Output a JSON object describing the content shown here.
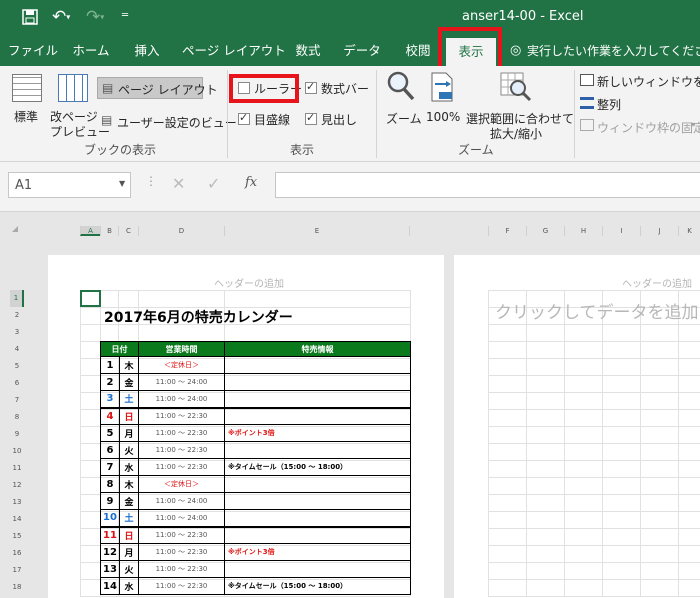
{
  "titlebar": {
    "title": "anser14-00 - Excel",
    "save_icon": "save-icon",
    "undo_icon": "undo-icon",
    "redo_icon": "redo-icon",
    "customize_icon": "customize-icon"
  },
  "tabs": [
    {
      "label": "ファイル"
    },
    {
      "label": "ホーム"
    },
    {
      "label": "挿入"
    },
    {
      "label": "ページ レイアウト"
    },
    {
      "label": "数式"
    },
    {
      "label": "データ"
    },
    {
      "label": "校閲"
    },
    {
      "label": "表示",
      "active": true
    }
  ],
  "tell_me": "実行したい作業を入力してください",
  "ribbon": {
    "views": {
      "normal": "標準",
      "page_break_l1": "改ページ",
      "page_break_l2": "プレビュー",
      "page_layout": "ページ レイアウト",
      "custom_views": "ユーザー設定のビュー",
      "group": "ブックの表示"
    },
    "show": {
      "ruler": "ルーラー",
      "formula_bar": "数式バー",
      "gridlines": "目盛線",
      "headings": "見出し",
      "group": "表示",
      "ruler_checked": false,
      "formula_bar_checked": true,
      "gridlines_checked": true,
      "headings_checked": true
    },
    "zoom": {
      "zoom": "ズーム",
      "hundred": "100%",
      "selection_l1": "選択範囲に合わせて",
      "selection_l2": "拡大/縮小",
      "group": "ズーム"
    },
    "window": {
      "new_window": "新しいウィンドウを開く",
      "arrange": "整列",
      "freeze": "ウィンドウ枠の固定"
    }
  },
  "formula_bar": {
    "name_box": "A1",
    "fx": "fx"
  },
  "sheet": {
    "col_headers_left": [
      "A",
      "B",
      "C",
      "D",
      "E"
    ],
    "col_headers_right": [
      "F",
      "G",
      "H",
      "I",
      "J",
      "K"
    ],
    "header_add": "ヘッダーの追加",
    "header_add_right": "ヘッダーの追加",
    "click_to_add": "クリックしてデータを追加",
    "calendar_title": "2017年6月の特売カレンダー",
    "table_headers": [
      "日付",
      "営業時間",
      "特売情報"
    ],
    "rows": [
      {
        "n": "1",
        "d": "木",
        "time": "＜定休日＞",
        "info": "",
        "dc": "#000",
        "tc": "#e01010"
      },
      {
        "n": "2",
        "d": "金",
        "time": "11:00 ～ 24:00",
        "info": "",
        "dc": "#000",
        "tc": "#555"
      },
      {
        "n": "3",
        "d": "土",
        "time": "11:00 ～ 24:00",
        "info": "",
        "dc": "#1a6fd0",
        "tc": "#555"
      },
      {
        "n": "4",
        "d": "日",
        "time": "11:00 ～ 22:30",
        "info": "",
        "dc": "#e01010",
        "tc": "#555"
      },
      {
        "n": "5",
        "d": "月",
        "time": "11:00 ～ 22:30",
        "info": "※ポイント3倍",
        "dc": "#000",
        "tc": "#555",
        "ic": "#e01010"
      },
      {
        "n": "6",
        "d": "火",
        "time": "11:00 ～ 22:30",
        "info": "",
        "dc": "#000",
        "tc": "#555"
      },
      {
        "n": "7",
        "d": "水",
        "time": "11:00 ～ 22:30",
        "info": "※タイムセール（15:00 ～ 18:00）",
        "dc": "#000",
        "tc": "#555",
        "ic": "#000"
      },
      {
        "n": "8",
        "d": "木",
        "time": "＜定休日＞",
        "info": "",
        "dc": "#000",
        "tc": "#e01010"
      },
      {
        "n": "9",
        "d": "金",
        "time": "11:00 ～ 24:00",
        "info": "",
        "dc": "#000",
        "tc": "#555"
      },
      {
        "n": "10",
        "d": "土",
        "time": "11:00 ～ 24:00",
        "info": "",
        "dc": "#1a6fd0",
        "tc": "#555"
      },
      {
        "n": "11",
        "d": "日",
        "time": "11:00 ～ 22:30",
        "info": "",
        "dc": "#e01010",
        "tc": "#555"
      },
      {
        "n": "12",
        "d": "月",
        "time": "11:00 ～ 22:30",
        "info": "※ポイント3倍",
        "dc": "#000",
        "tc": "#555",
        "ic": "#e01010"
      },
      {
        "n": "13",
        "d": "火",
        "time": "11:00 ～ 22:30",
        "info": "",
        "dc": "#000",
        "tc": "#555"
      },
      {
        "n": "14",
        "d": "水",
        "time": "11:00 ～ 22:30",
        "info": "※タイムセール（15:00 ～ 18:00）",
        "dc": "#000",
        "tc": "#555",
        "ic": "#000"
      }
    ],
    "row_numbers": [
      "1",
      "2",
      "3",
      "4",
      "5",
      "6",
      "7",
      "8",
      "9",
      "10",
      "11",
      "12",
      "13",
      "14",
      "15",
      "16",
      "17",
      "18"
    ]
  },
  "colors": {
    "excel_green": "#217346",
    "highlight_red": "#e8141b",
    "table_header_green": "#0b7a1c"
  }
}
